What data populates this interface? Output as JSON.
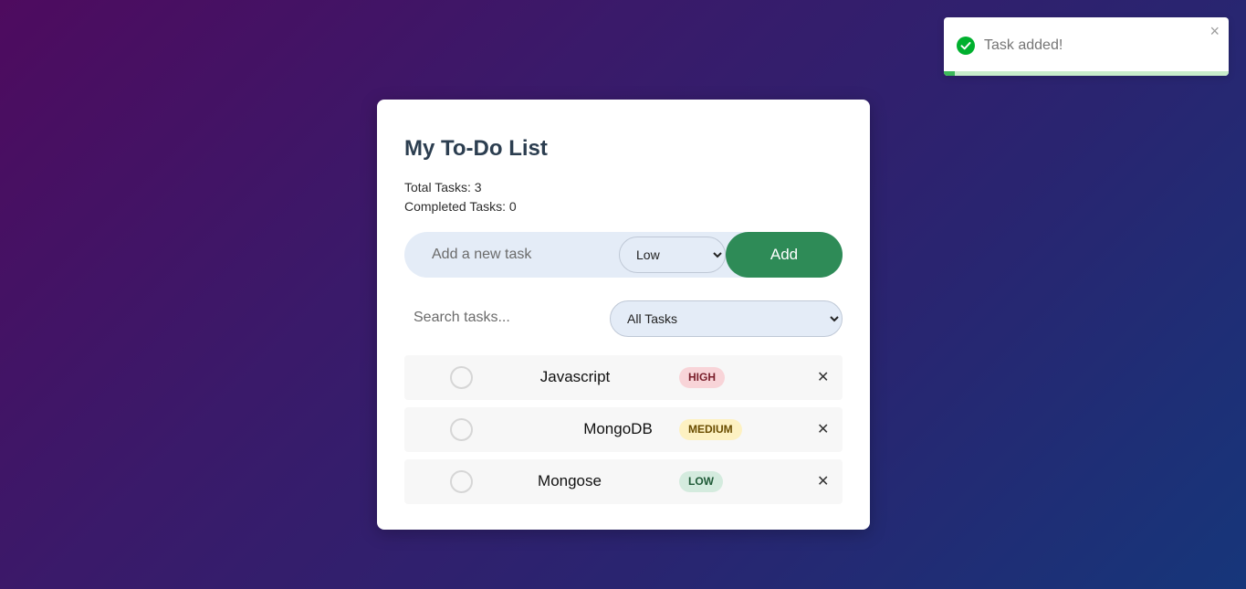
{
  "toast": {
    "icon": "check-circle-icon",
    "message": "Task added!",
    "close_glyph": "×",
    "progress": 0.04,
    "colors": {
      "success": "#00b02e",
      "progress": "#3cb95a"
    }
  },
  "card": {
    "title": "My To-Do List",
    "total_tasks": "Total Tasks: 3",
    "completed_tasks": "Completed Tasks: 0"
  },
  "add_form": {
    "placeholder": "Add a new task",
    "priority_selected": "Low",
    "add_label": "Add"
  },
  "filters": {
    "search_placeholder": "Search tasks...",
    "filter_selected": "All Tasks"
  },
  "tasks": [
    {
      "name": "Javascript",
      "priority": "HIGH",
      "completed": false
    },
    {
      "name": "MongoDB",
      "priority": "MEDIUM",
      "completed": false
    },
    {
      "name": "Mongose",
      "priority": "LOW",
      "completed": false
    }
  ],
  "delete_glyph": "✕",
  "colors": {
    "title": "#2c3e50",
    "add_button": "#2e8b57",
    "input_bg": "#e4ecf7"
  }
}
